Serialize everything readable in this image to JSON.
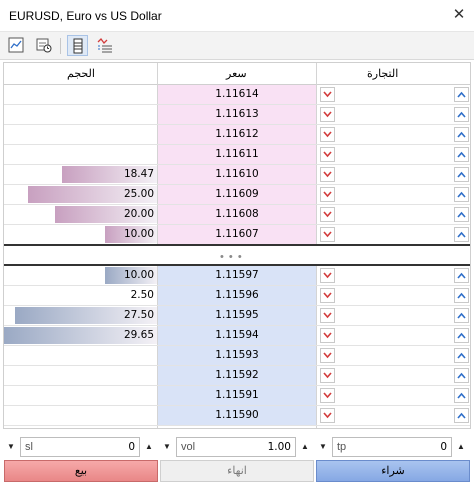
{
  "window": {
    "title": "EURUSD, Euro vs US Dollar",
    "close_glyph": "✕"
  },
  "toolbar": {
    "icons": [
      "chart-icon",
      "clock-chart-icon",
      "depth-of-market-icon",
      "tick-chart-icon"
    ]
  },
  "columns": {
    "volume": "الحجم",
    "price": "سعر",
    "trade": "التجارة"
  },
  "asks": [
    {
      "price": "1.11614",
      "volume": "",
      "level": 0
    },
    {
      "price": "1.11613",
      "volume": "",
      "level": 0
    },
    {
      "price": "1.11612",
      "volume": "",
      "level": 0
    },
    {
      "price": "1.11611",
      "volume": "",
      "level": 0
    },
    {
      "price": "1.11610",
      "volume": "18.47",
      "level": 0.62
    },
    {
      "price": "1.11609",
      "volume": "25.00",
      "level": 0.84
    },
    {
      "price": "1.11608",
      "volume": "20.00",
      "level": 0.67
    },
    {
      "price": "1.11607",
      "volume": "10.00",
      "level": 0.34
    }
  ],
  "spread_marker": "• • •",
  "bids": [
    {
      "price": "1.11597",
      "volume": "10.00",
      "level": 0.34
    },
    {
      "price": "1.11596",
      "volume": "2.50",
      "level": 0
    },
    {
      "price": "1.11595",
      "volume": "27.50",
      "level": 0.93
    },
    {
      "price": "1.11594",
      "volume": "29.65",
      "level": 1.0
    },
    {
      "price": "1.11593",
      "volume": "",
      "level": 0
    },
    {
      "price": "1.11592",
      "volume": "",
      "level": 0
    },
    {
      "price": "1.11591",
      "volume": "",
      "level": 0
    },
    {
      "price": "1.11590",
      "volume": "",
      "level": 0
    }
  ],
  "order": {
    "sl": {
      "label": "sl",
      "value": "0"
    },
    "vol": {
      "label": "vol",
      "value": "1.00"
    },
    "tp": {
      "label": "tp",
      "value": "0"
    }
  },
  "actions": {
    "sell": "بيع",
    "close": "انهاء",
    "buy": "شراء"
  },
  "colors": {
    "ask_bg": "#f9e1f4",
    "bid_bg": "#d9e3f7",
    "ask_bar": "#c8a0c0",
    "bid_bar": "#9aa9c4",
    "chevron_down": "#d23c3c",
    "chevron_up": "#2f6fc9"
  }
}
